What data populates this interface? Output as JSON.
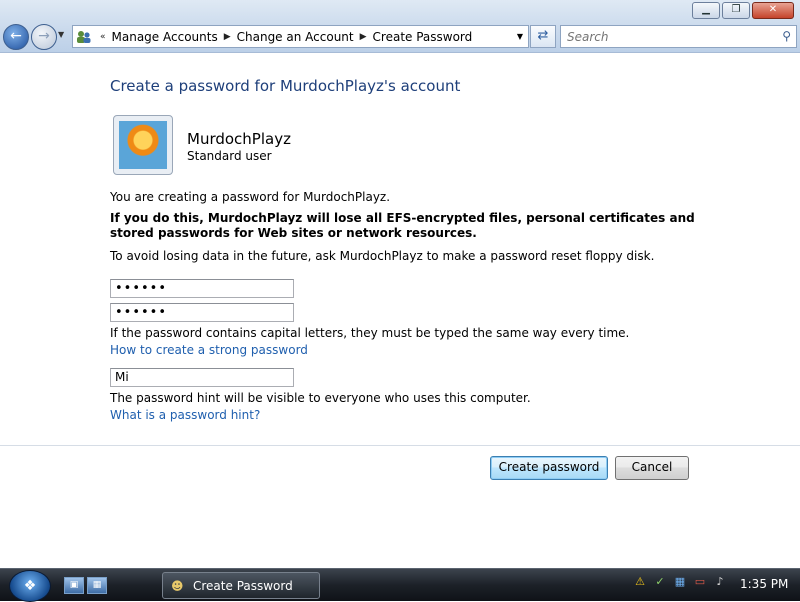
{
  "window": {
    "minimize_label": "▁",
    "maximize_label": "❐",
    "close_label": "✕"
  },
  "nav": {
    "back_icon": "back-arrow-icon",
    "forward_icon": "forward-arrow-icon"
  },
  "address": {
    "prefix": "«",
    "breadcrumbs": [
      "Manage Accounts",
      "Change an Account",
      "Create Password"
    ]
  },
  "search": {
    "placeholder": "Search"
  },
  "page": {
    "heading": "Create a password for MurdochPlayz's account",
    "user": {
      "name": "MurdochPlayz",
      "type": "Standard user"
    },
    "intro": "You are creating a password for MurdochPlayz.",
    "warning": "If you do this, MurdochPlayz will lose all EFS-encrypted files, personal certificates and stored passwords for Web sites or network resources.",
    "advice": "To avoid losing data in the future, ask MurdochPlayz to make a password reset floppy disk.",
    "password_value": "••••••",
    "confirm_value": "••••••",
    "case_note": "If the password contains capital letters, they must be typed the same way every time.",
    "strong_link": "How to create a strong password",
    "hint_value": "Mi",
    "hint_note": "The password hint will be visible to everyone who uses this computer.",
    "hint_link": "What is a password hint?"
  },
  "buttons": {
    "create": "Create password",
    "cancel": "Cancel"
  },
  "taskbar": {
    "start_icon": "windows-orb-icon",
    "task_label": "Create Password",
    "clock": "1:35 PM"
  },
  "colors": {
    "heading": "#1e3f7a",
    "link": "#1f5fae",
    "taskbar": "#1c2128"
  }
}
